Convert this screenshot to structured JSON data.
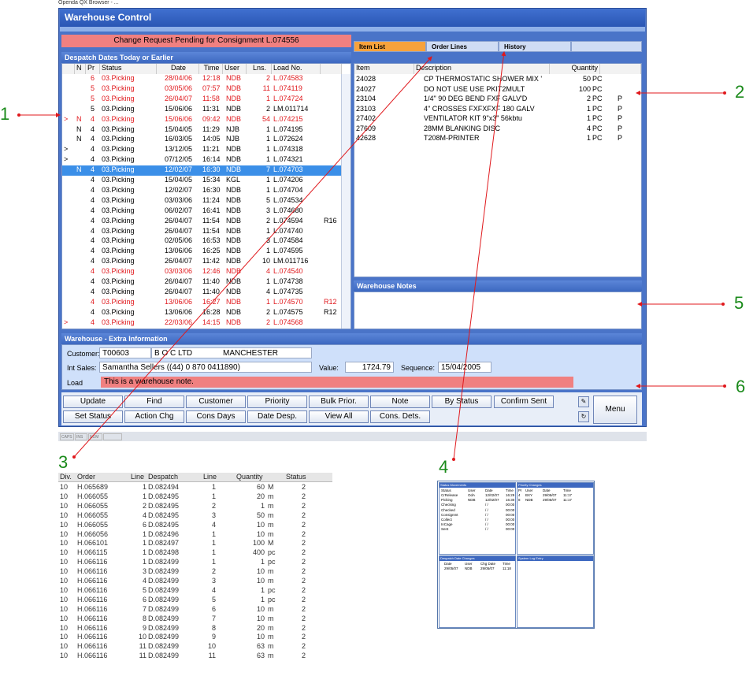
{
  "browser_title": "Openda QX Browser - ...",
  "app_title": "Warehouse Control",
  "change_request": "Change Request Pending for Consignment L.074556",
  "despatch": {
    "title": "Despatch Dates Today or Earlier",
    "columns": [
      "N",
      "Pr",
      "Status",
      "Date",
      "Time",
      "User",
      "Lns.",
      "Load No."
    ],
    "rows": [
      {
        "m": "",
        "n": "",
        "pr": "6",
        "status": "03.Picking",
        "date": "28/04/06",
        "time": "12:18",
        "user": "NDB",
        "lns": "2",
        "load": "L.074583",
        "extra": "",
        "red": true
      },
      {
        "m": "",
        "n": "",
        "pr": "5",
        "status": "03.Picking",
        "date": "03/05/06",
        "time": "07:57",
        "user": "NDB",
        "lns": "11",
        "load": "L.074119",
        "extra": "",
        "red": true
      },
      {
        "m": "",
        "n": "",
        "pr": "5",
        "status": "03.Picking",
        "date": "26/04/07",
        "time": "11:58",
        "user": "NDB",
        "lns": "1",
        "load": "L.074724",
        "extra": "",
        "red": true
      },
      {
        "m": "",
        "n": "",
        "pr": "5",
        "status": "03.Picking",
        "date": "15/06/06",
        "time": "11:31",
        "user": "NDB",
        "lns": "2",
        "load": "LM.011714",
        "extra": "",
        "red": false
      },
      {
        "m": ">",
        "n": "N",
        "pr": "4",
        "status": "03.Picking",
        "date": "15/06/06",
        "time": "09:42",
        "user": "NDB",
        "lns": "54",
        "load": "L.074215",
        "extra": "",
        "red": true
      },
      {
        "m": "",
        "n": "N",
        "pr": "4",
        "status": "03.Picking",
        "date": "15/04/05",
        "time": "11:29",
        "user": "NJB",
        "lns": "1",
        "load": "L.074195",
        "extra": "",
        "red": false
      },
      {
        "m": "",
        "n": "N",
        "pr": "4",
        "status": "03.Picking",
        "date": "16/03/05",
        "time": "14:05",
        "user": "NJB",
        "lns": "1",
        "load": "L.072624",
        "extra": "",
        "red": false
      },
      {
        "m": ">",
        "n": "",
        "pr": "4",
        "status": "03.Picking",
        "date": "13/12/05",
        "time": "11:21",
        "user": "NDB",
        "lns": "1",
        "load": "L.074318",
        "extra": "",
        "red": false
      },
      {
        "m": ">",
        "n": "",
        "pr": "4",
        "status": "03.Picking",
        "date": "07/12/05",
        "time": "16:14",
        "user": "NDB",
        "lns": "1",
        "load": "L.074321",
        "extra": "",
        "red": false
      },
      {
        "m": "",
        "n": "N",
        "pr": "4",
        "status": "03.Picking",
        "date": "12/02/07",
        "time": "16:30",
        "user": "NDB",
        "lns": "7",
        "load": "L.074703",
        "extra": "",
        "red": false,
        "selected": true
      },
      {
        "m": "",
        "n": "",
        "pr": "4",
        "status": "03.Picking",
        "date": "15/04/05",
        "time": "15:34",
        "user": "KGL",
        "lns": "1",
        "load": "L.074206",
        "extra": "",
        "red": false
      },
      {
        "m": "",
        "n": "",
        "pr": "4",
        "status": "03.Picking",
        "date": "12/02/07",
        "time": "16:30",
        "user": "NDB",
        "lns": "1",
        "load": "L.074704",
        "extra": "",
        "red": false
      },
      {
        "m": "",
        "n": "",
        "pr": "4",
        "status": "03.Picking",
        "date": "03/03/06",
        "time": "11:24",
        "user": "NDB",
        "lns": "5",
        "load": "L.074534",
        "extra": "",
        "red": false
      },
      {
        "m": "",
        "n": "",
        "pr": "4",
        "status": "03.Picking",
        "date": "06/02/07",
        "time": "16:41",
        "user": "NDB",
        "lns": "3",
        "load": "L.074680",
        "extra": "",
        "red": false
      },
      {
        "m": "",
        "n": "",
        "pr": "4",
        "status": "03.Picking",
        "date": "26/04/07",
        "time": "11:54",
        "user": "NDB",
        "lns": "2",
        "load": "L.074594",
        "extra": "R16",
        "red": false
      },
      {
        "m": "",
        "n": "",
        "pr": "4",
        "status": "03.Picking",
        "date": "26/04/07",
        "time": "11:54",
        "user": "NDB",
        "lns": "1",
        "load": "L.074740",
        "extra": "",
        "red": false
      },
      {
        "m": "",
        "n": "",
        "pr": "4",
        "status": "03.Picking",
        "date": "02/05/06",
        "time": "16:53",
        "user": "NDB",
        "lns": "3",
        "load": "L.074584",
        "extra": "",
        "red": false
      },
      {
        "m": "",
        "n": "",
        "pr": "4",
        "status": "03.Picking",
        "date": "13/06/06",
        "time": "16:25",
        "user": "NDB",
        "lns": "1",
        "load": "L.074595",
        "extra": "",
        "red": false
      },
      {
        "m": "",
        "n": "",
        "pr": "4",
        "status": "03.Picking",
        "date": "26/04/07",
        "time": "11:42",
        "user": "NDB",
        "lns": "10",
        "load": "LM.011716",
        "extra": "",
        "red": false
      },
      {
        "m": "",
        "n": "",
        "pr": "4",
        "status": "03.Picking",
        "date": "03/03/06",
        "time": "12:46",
        "user": "NDB",
        "lns": "4",
        "load": "L.074540",
        "extra": "",
        "red": true
      },
      {
        "m": "",
        "n": "",
        "pr": "4",
        "status": "03.Picking",
        "date": "26/04/07",
        "time": "11:40",
        "user": "NDB",
        "lns": "1",
        "load": "L.074738",
        "extra": "",
        "red": false
      },
      {
        "m": "",
        "n": "",
        "pr": "4",
        "status": "03.Picking",
        "date": "26/04/07",
        "time": "11:40",
        "user": "NDB",
        "lns": "4",
        "load": "L.074735",
        "extra": "",
        "red": false
      },
      {
        "m": "",
        "n": "",
        "pr": "4",
        "status": "03.Picking",
        "date": "13/06/06",
        "time": "16:27",
        "user": "NDB",
        "lns": "1",
        "load": "L.074570",
        "extra": "R12",
        "red": true
      },
      {
        "m": "",
        "n": "",
        "pr": "4",
        "status": "03.Picking",
        "date": "13/06/06",
        "time": "16:28",
        "user": "NDB",
        "lns": "2",
        "load": "L.074575",
        "extra": "R12",
        "red": false
      },
      {
        "m": ">",
        "n": "",
        "pr": "4",
        "status": "03.Picking",
        "date": "22/03/06",
        "time": "14:15",
        "user": "NDB",
        "lns": "2",
        "load": "L.074568",
        "extra": "",
        "red": true
      }
    ]
  },
  "tabs": [
    "Item List",
    "Order Lines",
    "History"
  ],
  "items": {
    "columns": [
      "Item",
      "Description",
      "Quantity"
    ],
    "rows": [
      {
        "item": "24028",
        "desc": "CP THERMOSTATIC SHOWER MIX '",
        "qty": "50",
        "unit": "PC",
        "flag": ""
      },
      {
        "item": "24027",
        "desc": "DO NOT USE USE PKIT2MULT",
        "qty": "100",
        "unit": "PC",
        "flag": ""
      },
      {
        "item": "23104",
        "desc": "1/4\" 90 DEG BEND FXF GALV'D",
        "qty": "2",
        "unit": "PC",
        "flag": "P"
      },
      {
        "item": "23103",
        "desc": "4\" CROSSES FXFXFXF 180 GALV",
        "qty": "1",
        "unit": "PC",
        "flag": "P"
      },
      {
        "item": "27402",
        "desc": "VENTILATOR KIT 9\"x3\"  56kbtu",
        "qty": "1",
        "unit": "PC",
        "flag": "P"
      },
      {
        "item": "27609",
        "desc": "28MM BLANKING DISC",
        "qty": "4",
        "unit": "PC",
        "flag": "P"
      },
      {
        "item": "42628",
        "desc": "T208M-PRINTER",
        "qty": "1",
        "unit": "PC",
        "flag": "P"
      }
    ]
  },
  "notes": {
    "title": "Warehouse Notes"
  },
  "extra": {
    "title": "Warehouse - Extra Information",
    "customer_label": "Customer:",
    "customer_code": "T00603",
    "customer_name": "B O C LTD",
    "customer_town": "MANCHESTER",
    "int_sales_label": "Int Sales:",
    "int_sales": "Samantha Sellers ((44) 0 870 0411890)",
    "value_label": "Value:",
    "value": "1724.79",
    "sequence_label": "Sequence:",
    "sequence": "15/04/2005",
    "load_label": "Load",
    "load_note": "This is a warehouse note."
  },
  "buttons": {
    "row1": [
      "Update",
      "Find",
      "Customer",
      "Priority",
      "Bulk Prior.",
      "Note",
      "By Status",
      "Confirm Sent"
    ],
    "row2": [
      "Set Status",
      "Action Chg",
      "Cons Days",
      "Date Desp.",
      "View All",
      "Cons. Dets."
    ],
    "menu": "Menu"
  },
  "status_bar": [
    "CAPS",
    "INS",
    "NUM"
  ],
  "callouts": [
    "1",
    "2",
    "3",
    "4",
    "5",
    "6"
  ],
  "order_lines": {
    "columns": [
      "Div.",
      "Order",
      "Line",
      "Despatch",
      "Line",
      "Quantity",
      "Status"
    ],
    "rows": [
      [
        "10",
        "H.065689",
        "1",
        "D.082494",
        "1",
        "60",
        "M",
        "2"
      ],
      [
        "10",
        "H.066055",
        "1",
        "D.082495",
        "1",
        "20",
        "m",
        "2"
      ],
      [
        "10",
        "H.066055",
        "2",
        "D.082495",
        "2",
        "1",
        "m",
        "2"
      ],
      [
        "10",
        "H.066055",
        "4",
        "D.082495",
        "3",
        "50",
        "m",
        "2"
      ],
      [
        "10",
        "H.066055",
        "6",
        "D.082495",
        "4",
        "10",
        "m",
        "2"
      ],
      [
        "10",
        "H.066056",
        "1",
        "D.082496",
        "1",
        "10",
        "m",
        "2"
      ],
      [
        "10",
        "H.066101",
        "1",
        "D.082497",
        "1",
        "100",
        "M",
        "2"
      ],
      [
        "10",
        "H.066115",
        "1",
        "D.082498",
        "1",
        "400",
        "pc",
        "2"
      ],
      [
        "10",
        "H.066116",
        "1",
        "D.082499",
        "1",
        "1",
        "pc",
        "2"
      ],
      [
        "10",
        "H.066116",
        "3",
        "D.082499",
        "2",
        "10",
        "m",
        "2"
      ],
      [
        "10",
        "H.066116",
        "4",
        "D.082499",
        "3",
        "10",
        "m",
        "2"
      ],
      [
        "10",
        "H.066116",
        "5",
        "D.082499",
        "4",
        "1",
        "pc",
        "2"
      ],
      [
        "10",
        "H.066116",
        "6",
        "D.082499",
        "5",
        "1",
        "pc",
        "2"
      ],
      [
        "10",
        "H.066116",
        "7",
        "D.082499",
        "6",
        "10",
        "m",
        "2"
      ],
      [
        "10",
        "H.066116",
        "8",
        "D.082499",
        "7",
        "10",
        "m",
        "2"
      ],
      [
        "10",
        "H.066116",
        "9",
        "D.082499",
        "8",
        "20",
        "m",
        "2"
      ],
      [
        "10",
        "H.066116",
        "10",
        "D.082499",
        "9",
        "10",
        "m",
        "2"
      ],
      [
        "10",
        "H.066116",
        "11",
        "D.082499",
        "10",
        "63",
        "m",
        "2"
      ],
      [
        "10",
        "H.066116",
        "11",
        "D.082499",
        "11",
        "63",
        "m",
        "2"
      ]
    ]
  },
  "history": {
    "status_title": "Status Movements",
    "status_cols": [
      "Status",
      "User",
      "Date",
      "Time"
    ],
    "status_rows": [
      [
        "CrRelease",
        "OdA",
        "12/02/07",
        "16:29"
      ],
      [
        "Picking",
        "NDB",
        "12/02/07",
        "16:30"
      ],
      [
        "Checking",
        "",
        "/ /",
        "00:00"
      ],
      [
        "Checked",
        "",
        "/ /",
        "00:00"
      ],
      [
        "Consignmt",
        "",
        "/ /",
        "00:00"
      ],
      [
        "Collect",
        "",
        "/ /",
        "00:00"
      ],
      [
        "InCage",
        "",
        "/ /",
        "00:00"
      ],
      [
        "Sent",
        "",
        "/ /",
        "00:00"
      ]
    ],
    "priority_title": "Priority Changes",
    "priority_cols": [
      "Pr",
      "User",
      "Date",
      "Time"
    ],
    "priority_rows": [
      [
        "4",
        "BXY",
        "29/05/07",
        "11:17"
      ],
      [
        "8",
        "NDB",
        "29/05/07",
        "11:17"
      ]
    ],
    "despatch_title": "Despatch Date Changes",
    "despatch_cols": [
      "Date",
      "User",
      "Chg Date",
      "Time"
    ],
    "despatch_rows": [
      [
        "29/05/07",
        "NDB",
        "29/05/07",
        "11:18"
      ]
    ],
    "log_title": "System Log Entry"
  },
  "colors": {
    "window_blue": "#4a74c8",
    "alert_red": "#e0181c",
    "note_pink": "#f08080",
    "selected_row": "#3b8fe8",
    "active_tab": "#f7a23c",
    "callout_green": "#1a8a1a"
  }
}
